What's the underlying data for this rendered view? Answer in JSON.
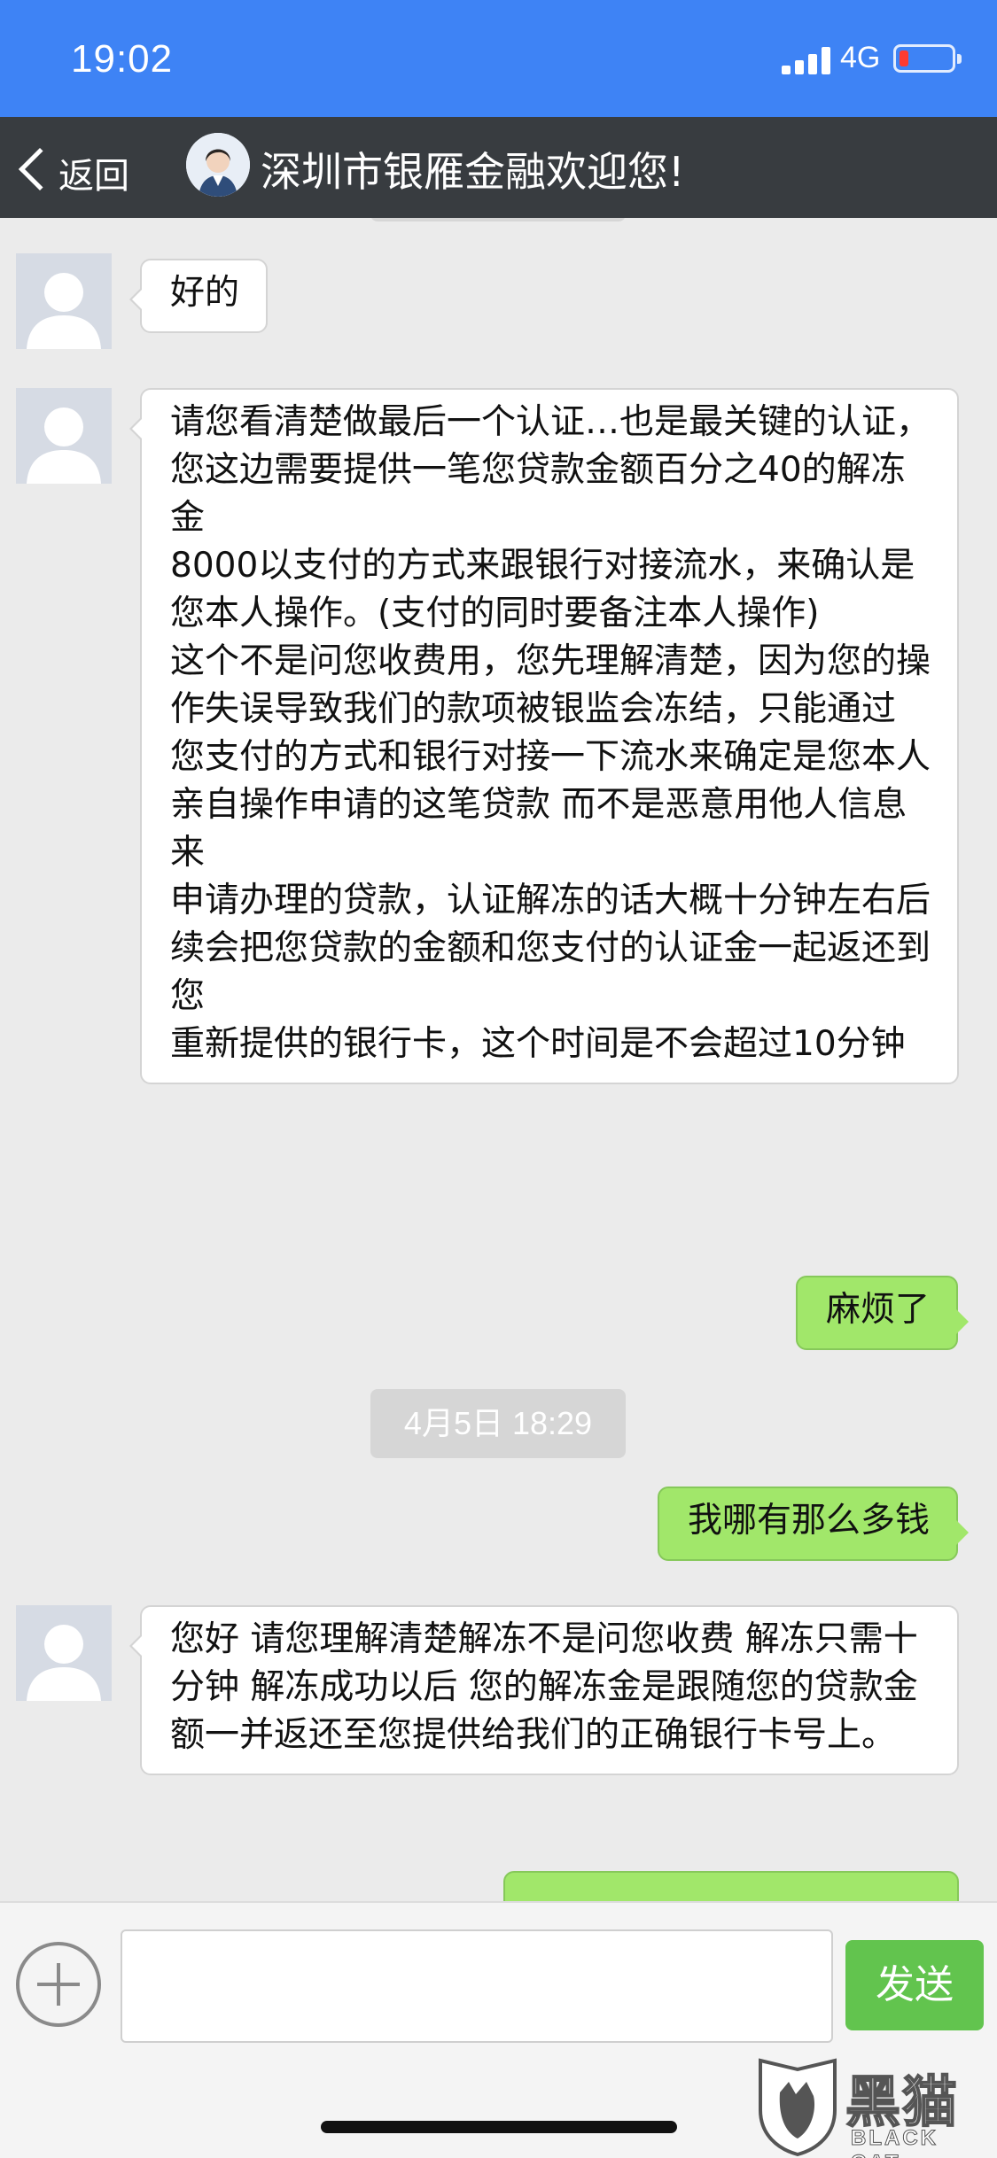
{
  "status_bar": {
    "time": "19:02",
    "network": "4G",
    "battery_color": "#ff3b30"
  },
  "nav": {
    "back_label": "返回",
    "title": "深圳市银雁金融欢迎您!"
  },
  "messages": [
    {
      "side": "left",
      "text": "好的"
    },
    {
      "side": "left",
      "text": "请您看清楚做最后一个认证…也是最关键的认证，您这边需要提供一笔您贷款金额百分之40的解冻金\n8000以支付的方式来跟银行对接流水，来确认是您本人操作。(支付的同时要备注本人操作)\n这个不是问您收费用，您先理解清楚，因为您的操作失误导致我们的款项被银监会冻结，只能通过\n您支付的方式和银行对接一下流水来确定是您本人亲自操作申请的这笔贷款 而不是恶意用他人信息来\n申请办理的贷款，认证解冻的话大概十分钟左右后续会把您贷款的金额和您支付的认证金一起返还到您\n 重新提供的银行卡，这个时间是不会超过10分钟"
    },
    {
      "side": "right",
      "text": "麻烦了"
    },
    {
      "side": "timestamp",
      "text": "4月5日 18:29"
    },
    {
      "side": "right",
      "text": "我哪有那么多钱"
    },
    {
      "side": "left",
      "text": "您好 请您理解清楚解冻不是问您收费 解冻只需十分钟 解冻成功以后 您的解冻金是跟随您的贷款金额一并返还至您提供给我们的正确银行卡号上。"
    }
  ],
  "input_bar": {
    "input_value": "",
    "send_label": "发送"
  },
  "watermark": {
    "text": "黑猫",
    "subtext": "BLACK CAT"
  },
  "colors": {
    "status_bar": "#3e83f5",
    "nav_bar": "#383c40",
    "right_bubble": "#a1e76a",
    "send_button": "#62c44e"
  }
}
